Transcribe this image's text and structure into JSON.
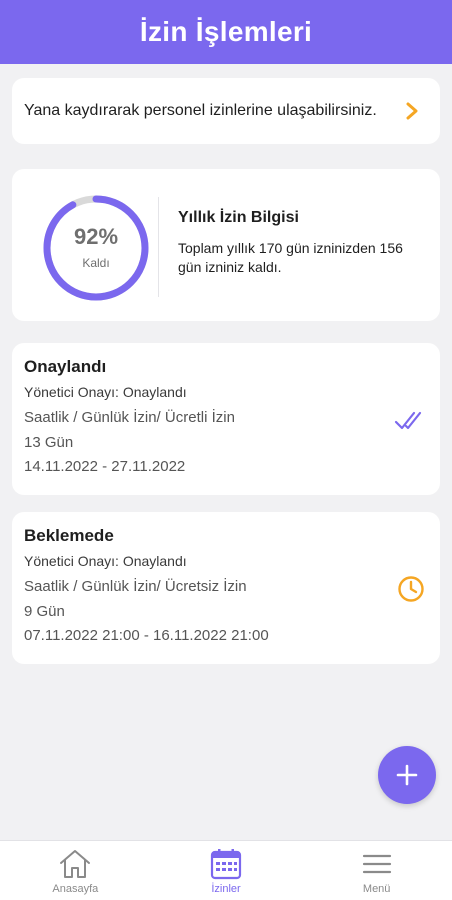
{
  "header": {
    "title": "İzin İşlemleri"
  },
  "swipe_hint": {
    "text": "Yana kaydırarak personel izinlerine ulaşabilirsiniz.",
    "icon": "chevron-right-icon",
    "icon_color": "#f5a623"
  },
  "leave_info": {
    "remaining_fraction": 0.92,
    "percent_text": "92%",
    "remaining_label": "Kaldı",
    "title": "Yıllık İzin Bilgisi",
    "description": "Toplam yıllık 170 gün izninizden 156 gün izniniz kaldı.",
    "ring_color": "#7b68ee",
    "ring_track_color": "#d9d9d9"
  },
  "leave_requests": [
    {
      "status": "Onaylandı",
      "approval": "Yönetici Onayı: Onaylandı",
      "type": "Saatlik / Günlük İzin/ Ücretli İzin",
      "days": "13 Gün",
      "dates": "14.11.2022 - 27.11.2022",
      "icon": "double-check-icon",
      "icon_color": "#7b68ee"
    },
    {
      "status": "Beklemede",
      "approval": "Yönetici Onayı: Onaylandı",
      "type": "Saatlik / Günlük İzin/ Ücretsiz İzin",
      "days": "9 Gün",
      "dates": "07.11.2022 21:00 - 16.11.2022 21:00",
      "icon": "clock-icon",
      "icon_color": "#f5a623"
    }
  ],
  "fab": {
    "icon": "plus-icon"
  },
  "bottom_nav": {
    "items": [
      {
        "label": "Anasayfa",
        "icon": "home-icon",
        "active": false
      },
      {
        "label": "İzinler",
        "icon": "calendar-icon",
        "active": true
      },
      {
        "label": "Menü",
        "icon": "menu-icon",
        "active": false
      }
    ]
  },
  "colors": {
    "accent": "#7b68ee",
    "background": "#f1f1f3",
    "card": "#ffffff",
    "warning": "#f5a623"
  }
}
